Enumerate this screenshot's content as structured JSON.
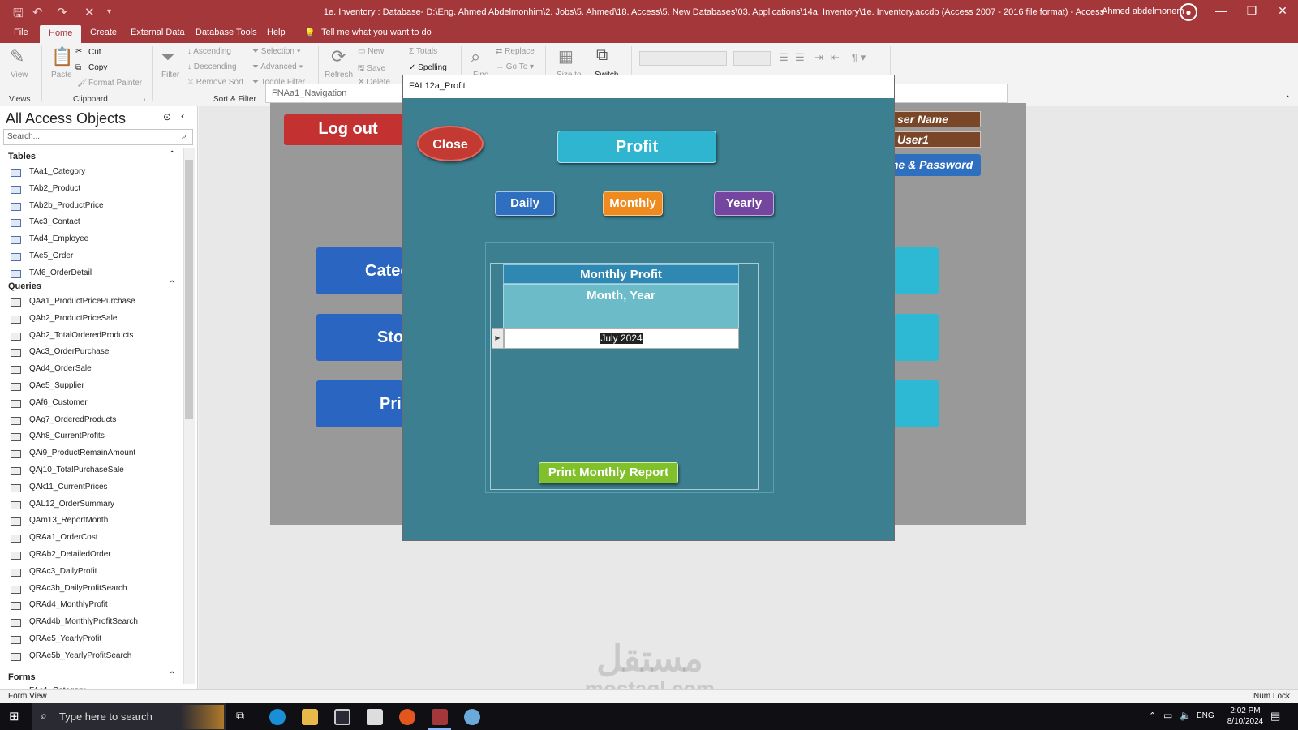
{
  "window": {
    "title": "1e. Inventory : Database- D:\\Eng. Ahmed Abdelmonhim\\2. Jobs\\5. Ahmed\\18. Access\\5. New Databases\\03. Applications\\14a. Inventory\\1e. Inventory.accdb (Access 2007 - 2016 file format) - Access",
    "user": "Ahmed abdelmonem"
  },
  "menu": {
    "tabs": [
      "File",
      "Home",
      "Create",
      "External Data",
      "Database Tools",
      "Help"
    ],
    "tell_me": "Tell me what you want to do"
  },
  "ribbon": {
    "views": {
      "view": "View",
      "group": "Views"
    },
    "clipboard": {
      "paste": "Paste",
      "cut": "Cut",
      "copy": "Copy",
      "format_painter": "Format Painter",
      "group": "Clipboard"
    },
    "sort_filter": {
      "filter": "Filter",
      "ascending": "Ascending",
      "descending": "Descending",
      "remove_sort": "Remove Sort",
      "selection": "Selection",
      "advanced": "Advanced",
      "toggle_filter": "Toggle Filter",
      "group": "Sort & Filter"
    },
    "records": {
      "refresh": "Refresh",
      "new": "New",
      "save": "Save",
      "delete": "Delete",
      "totals": "Totals",
      "spelling": "Spelling"
    },
    "find": {
      "find": "Find",
      "replace": "Replace",
      "go_to": "Go To"
    },
    "window": {
      "size_to_fit": "Size to",
      "switch": "Switch"
    }
  },
  "nav": {
    "title": "All Access Objects",
    "search_placeholder": "Search...",
    "sections": {
      "tables": "Tables",
      "queries": "Queries",
      "forms": "Forms"
    },
    "tables": [
      "TAa1_Category",
      "TAb2_Product",
      "TAb2b_ProductPrice",
      "TAc3_Contact",
      "TAd4_Employee",
      "TAe5_Order",
      "TAf6_OrderDetail"
    ],
    "queries": [
      "QAa1_ProductPricePurchase",
      "QAb2_ProductPriceSale",
      "QAb2_TotalOrderedProducts",
      "QAc3_OrderPurchase",
      "QAd4_OrderSale",
      "QAe5_Supplier",
      "QAf6_Customer",
      "QAg7_OrderedProducts",
      "QAh8_CurrentProfits",
      "QAi9_ProductRemainAmount",
      "QAj10_TotalPurchaseSale",
      "QAk11_CurrentPrices",
      "QAL12_OrderSummary",
      "QAm13_ReportMonth",
      "QRAa1_OrderCost",
      "QRAb2_DetailedOrder",
      "QRAc3_DailyProfit",
      "QRAc3b_DailyProfitSearch",
      "QRAd4_MonthlyProfit",
      "QRAd4b_MonthlyProfitSearch",
      "QRAe5_YearlyProfit",
      "QRAe5b_YearlyProfitSearch"
    ],
    "forms_partial": "FAa1_Category"
  },
  "nav_form": {
    "tab": "FNAa1_Navigation",
    "logout": "Log out",
    "user_name_label": "ser Name",
    "user_value": "User1",
    "change_pw": "me & Password",
    "left_buttons": [
      "Categ",
      "Sto",
      "Pri"
    ]
  },
  "dialog": {
    "title": "FAL12a_Profit",
    "close": "Close",
    "profit": "Profit",
    "daily": "Daily",
    "monthly": "Monthly",
    "yearly": "Yearly",
    "sub_header": "Monthly Profit",
    "column_header": "Month, Year",
    "row_value": "July 2024",
    "print": "Print Monthly Report"
  },
  "status": {
    "left": "Form View",
    "right": "Num Lock"
  },
  "taskbar": {
    "search": "Type here to search",
    "lang": "ENG",
    "time": "2:02 PM",
    "date": "8/10/2024"
  },
  "watermark": {
    "arabic": "مستقل",
    "latin": "mostaql.com"
  }
}
